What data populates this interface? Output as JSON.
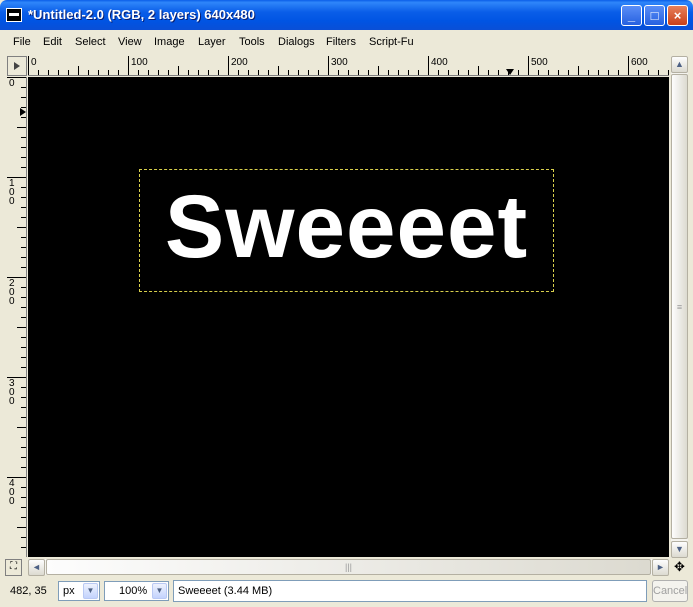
{
  "window": {
    "title": "*Untitled-2.0 (RGB, 2 layers) 640x480",
    "minimize": "_",
    "maximize": "□",
    "close": "×"
  },
  "menu": [
    "File",
    "Edit",
    "Select",
    "View",
    "Image",
    "Layer",
    "Tools",
    "Dialogs",
    "Filters",
    "Script-Fu"
  ],
  "rulers": {
    "horizontal_labels": [
      "0",
      "100",
      "200",
      "300",
      "400",
      "500",
      "600"
    ],
    "vertical_labels": [
      "0",
      "100",
      "200",
      "300",
      "400"
    ]
  },
  "canvas": {
    "background": "#000000",
    "text": "Sweeeet",
    "text_color": "#ffffff",
    "selection_color": "#d8d04c"
  },
  "scroll": {
    "up": "▲",
    "down": "▼",
    "left": "◄",
    "right": "►",
    "nav_icon": "navigate-icon",
    "move_icon": "move-icon"
  },
  "status": {
    "coords": "482, 35",
    "unit": "px",
    "zoom": "100%",
    "message": "Sweeeet (3.44 MB)",
    "cancel": "Cancel"
  }
}
